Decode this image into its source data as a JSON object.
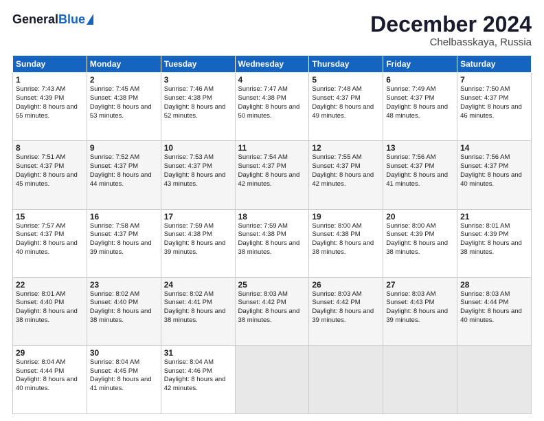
{
  "header": {
    "logo_general": "General",
    "logo_blue": "Blue",
    "month_title": "December 2024",
    "location": "Chelbasskaya, Russia"
  },
  "days_of_week": [
    "Sunday",
    "Monday",
    "Tuesday",
    "Wednesday",
    "Thursday",
    "Friday",
    "Saturday"
  ],
  "weeks": [
    [
      {
        "day": "1",
        "sunrise": "Sunrise: 7:43 AM",
        "sunset": "Sunset: 4:39 PM",
        "daylight": "Daylight: 8 hours and 55 minutes."
      },
      {
        "day": "2",
        "sunrise": "Sunrise: 7:45 AM",
        "sunset": "Sunset: 4:38 PM",
        "daylight": "Daylight: 8 hours and 53 minutes."
      },
      {
        "day": "3",
        "sunrise": "Sunrise: 7:46 AM",
        "sunset": "Sunset: 4:38 PM",
        "daylight": "Daylight: 8 hours and 52 minutes."
      },
      {
        "day": "4",
        "sunrise": "Sunrise: 7:47 AM",
        "sunset": "Sunset: 4:38 PM",
        "daylight": "Daylight: 8 hours and 50 minutes."
      },
      {
        "day": "5",
        "sunrise": "Sunrise: 7:48 AM",
        "sunset": "Sunset: 4:37 PM",
        "daylight": "Daylight: 8 hours and 49 minutes."
      },
      {
        "day": "6",
        "sunrise": "Sunrise: 7:49 AM",
        "sunset": "Sunset: 4:37 PM",
        "daylight": "Daylight: 8 hours and 48 minutes."
      },
      {
        "day": "7",
        "sunrise": "Sunrise: 7:50 AM",
        "sunset": "Sunset: 4:37 PM",
        "daylight": "Daylight: 8 hours and 46 minutes."
      }
    ],
    [
      {
        "day": "8",
        "sunrise": "Sunrise: 7:51 AM",
        "sunset": "Sunset: 4:37 PM",
        "daylight": "Daylight: 8 hours and 45 minutes."
      },
      {
        "day": "9",
        "sunrise": "Sunrise: 7:52 AM",
        "sunset": "Sunset: 4:37 PM",
        "daylight": "Daylight: 8 hours and 44 minutes."
      },
      {
        "day": "10",
        "sunrise": "Sunrise: 7:53 AM",
        "sunset": "Sunset: 4:37 PM",
        "daylight": "Daylight: 8 hours and 43 minutes."
      },
      {
        "day": "11",
        "sunrise": "Sunrise: 7:54 AM",
        "sunset": "Sunset: 4:37 PM",
        "daylight": "Daylight: 8 hours and 42 minutes."
      },
      {
        "day": "12",
        "sunrise": "Sunrise: 7:55 AM",
        "sunset": "Sunset: 4:37 PM",
        "daylight": "Daylight: 8 hours and 42 minutes."
      },
      {
        "day": "13",
        "sunrise": "Sunrise: 7:56 AM",
        "sunset": "Sunset: 4:37 PM",
        "daylight": "Daylight: 8 hours and 41 minutes."
      },
      {
        "day": "14",
        "sunrise": "Sunrise: 7:56 AM",
        "sunset": "Sunset: 4:37 PM",
        "daylight": "Daylight: 8 hours and 40 minutes."
      }
    ],
    [
      {
        "day": "15",
        "sunrise": "Sunrise: 7:57 AM",
        "sunset": "Sunset: 4:37 PM",
        "daylight": "Daylight: 8 hours and 40 minutes."
      },
      {
        "day": "16",
        "sunrise": "Sunrise: 7:58 AM",
        "sunset": "Sunset: 4:37 PM",
        "daylight": "Daylight: 8 hours and 39 minutes."
      },
      {
        "day": "17",
        "sunrise": "Sunrise: 7:59 AM",
        "sunset": "Sunset: 4:38 PM",
        "daylight": "Daylight: 8 hours and 39 minutes."
      },
      {
        "day": "18",
        "sunrise": "Sunrise: 7:59 AM",
        "sunset": "Sunset: 4:38 PM",
        "daylight": "Daylight: 8 hours and 38 minutes."
      },
      {
        "day": "19",
        "sunrise": "Sunrise: 8:00 AM",
        "sunset": "Sunset: 4:38 PM",
        "daylight": "Daylight: 8 hours and 38 minutes."
      },
      {
        "day": "20",
        "sunrise": "Sunrise: 8:00 AM",
        "sunset": "Sunset: 4:39 PM",
        "daylight": "Daylight: 8 hours and 38 minutes."
      },
      {
        "day": "21",
        "sunrise": "Sunrise: 8:01 AM",
        "sunset": "Sunset: 4:39 PM",
        "daylight": "Daylight: 8 hours and 38 minutes."
      }
    ],
    [
      {
        "day": "22",
        "sunrise": "Sunrise: 8:01 AM",
        "sunset": "Sunset: 4:40 PM",
        "daylight": "Daylight: 8 hours and 38 minutes."
      },
      {
        "day": "23",
        "sunrise": "Sunrise: 8:02 AM",
        "sunset": "Sunset: 4:40 PM",
        "daylight": "Daylight: 8 hours and 38 minutes."
      },
      {
        "day": "24",
        "sunrise": "Sunrise: 8:02 AM",
        "sunset": "Sunset: 4:41 PM",
        "daylight": "Daylight: 8 hours and 38 minutes."
      },
      {
        "day": "25",
        "sunrise": "Sunrise: 8:03 AM",
        "sunset": "Sunset: 4:42 PM",
        "daylight": "Daylight: 8 hours and 38 minutes."
      },
      {
        "day": "26",
        "sunrise": "Sunrise: 8:03 AM",
        "sunset": "Sunset: 4:42 PM",
        "daylight": "Daylight: 8 hours and 39 minutes."
      },
      {
        "day": "27",
        "sunrise": "Sunrise: 8:03 AM",
        "sunset": "Sunset: 4:43 PM",
        "daylight": "Daylight: 8 hours and 39 minutes."
      },
      {
        "day": "28",
        "sunrise": "Sunrise: 8:03 AM",
        "sunset": "Sunset: 4:44 PM",
        "daylight": "Daylight: 8 hours and 40 minutes."
      }
    ],
    [
      {
        "day": "29",
        "sunrise": "Sunrise: 8:04 AM",
        "sunset": "Sunset: 4:44 PM",
        "daylight": "Daylight: 8 hours and 40 minutes."
      },
      {
        "day": "30",
        "sunrise": "Sunrise: 8:04 AM",
        "sunset": "Sunset: 4:45 PM",
        "daylight": "Daylight: 8 hours and 41 minutes."
      },
      {
        "day": "31",
        "sunrise": "Sunrise: 8:04 AM",
        "sunset": "Sunset: 4:46 PM",
        "daylight": "Daylight: 8 hours and 42 minutes."
      },
      null,
      null,
      null,
      null
    ]
  ]
}
